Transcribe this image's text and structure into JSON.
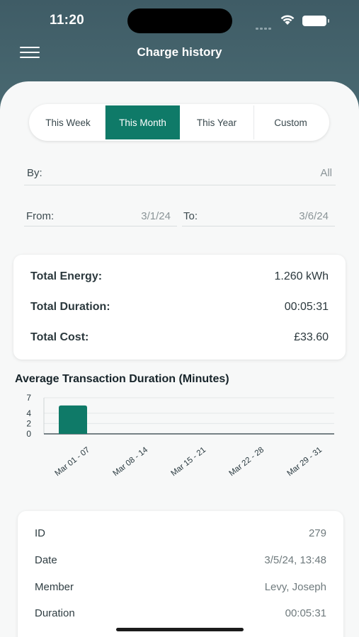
{
  "status_bar": {
    "time": "11:20"
  },
  "header": {
    "title": "Charge history"
  },
  "period_tabs": [
    {
      "label": "This Week",
      "active": false
    },
    {
      "label": "This Month",
      "active": true
    },
    {
      "label": "This Year",
      "active": false
    },
    {
      "label": "Custom",
      "active": false
    }
  ],
  "filters": {
    "by_label": "By:",
    "by_value": "All",
    "from_label": "From:",
    "from_value": "3/1/24",
    "to_label": "To:",
    "to_value": "3/6/24"
  },
  "totals": {
    "energy_label": "Total Energy:",
    "energy_value": "1.260 kWh",
    "duration_label": "Total Duration:",
    "duration_value": "00:05:31",
    "cost_label": "Total Cost:",
    "cost_value": "£33.60"
  },
  "chart_data": {
    "type": "bar",
    "title": "Average Transaction Duration (Minutes)",
    "categories": [
      "Mar 01 - 07",
      "Mar 08 - 14",
      "Mar 15 - 21",
      "Mar 22 - 28",
      "Mar 29 - 31"
    ],
    "values": [
      5.5,
      0,
      0,
      0,
      0
    ],
    "yticks": [
      0,
      2,
      4,
      7
    ],
    "ylim": [
      0,
      7
    ],
    "grid": true,
    "color": "#0f7a68"
  },
  "transaction": {
    "id_label": "ID",
    "id_value": "279",
    "date_label": "Date",
    "date_value": "3/5/24, 13:48",
    "member_label": "Member",
    "member_value": "Levy, Joseph",
    "duration_label": "Duration",
    "duration_value": "00:05:31"
  },
  "colors": {
    "header": "#44616a",
    "accent": "#0f7a68"
  }
}
